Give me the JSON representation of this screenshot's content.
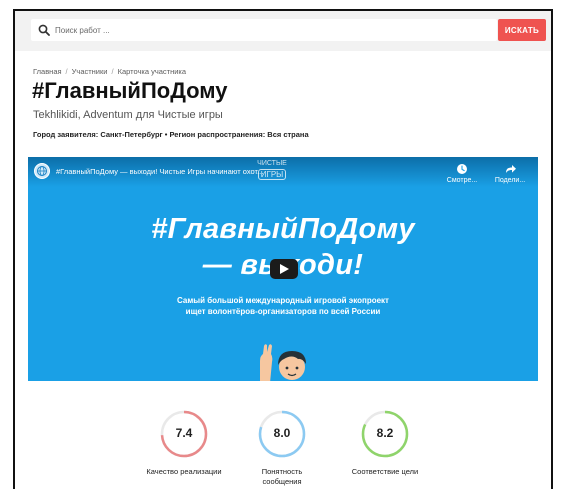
{
  "search": {
    "placeholder": "Поиск работ ...",
    "value": "",
    "button_label": "ИСКАТЬ",
    "button_color": "#ef5350"
  },
  "breadcrumb": [
    {
      "label": "Главная"
    },
    {
      "label": "Участники"
    },
    {
      "label": "Карточка участника"
    }
  ],
  "breadcrumb_separator": "/",
  "page": {
    "title": "#ГлавныйПоДому",
    "subtitle": "Tekhlikidi, Adventum для Чистые игры",
    "meta": "Город заявителя: Санкт-Петербург • Регион распространения: Вся страна"
  },
  "video": {
    "title": "#ГлавныйПоДому — выходи! Чистые Игры начинают охот...",
    "watermark_line1": "ЧИСТЫЕ",
    "watermark_line2": "ИГРЫ",
    "watch_label": "Смотре...",
    "share_label": "Подели...",
    "headline_line1": "#ГлавныйПоДому",
    "headline_line2": "— выходи!",
    "description_line1": "Самый большой международный игровой экопроект",
    "description_line2": "ищет волонтёров-организаторов по всей России",
    "background_color": "#1aa0e6",
    "icons": {
      "watch": "clock-icon",
      "share": "share-arrow-icon",
      "play": "play-icon"
    }
  },
  "ratings": [
    {
      "value": "7.4",
      "label_line1": "Качество реализации",
      "label_line2": "",
      "fraction": 0.74,
      "color": "#e8898a"
    },
    {
      "value": "8.0",
      "label_line1": "Понятность",
      "label_line2": "сообщения",
      "fraction": 0.8,
      "color": "#8ccaf2"
    },
    {
      "value": "8.2",
      "label_line1": "Соответствие цели",
      "label_line2": "",
      "fraction": 0.82,
      "color": "#8fd46b"
    }
  ]
}
